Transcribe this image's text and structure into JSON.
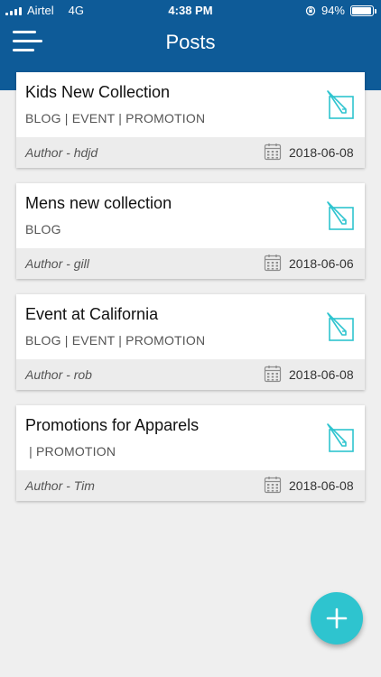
{
  "status_bar": {
    "carrier": "Airtel",
    "network": "4G",
    "time": "4:38 PM",
    "battery": "94%",
    "battery_level": 0.94
  },
  "header": {
    "title": "Posts",
    "menu_icon": "menu-icon"
  },
  "posts": [
    {
      "title": "Kids New Collection",
      "tags": "BLOG | EVENT | PROMOTION",
      "author": "Author - hdjd",
      "date": "2018-06-08"
    },
    {
      "title": "Mens new collection",
      "tags": "BLOG",
      "author": "Author - gill",
      "date": "2018-06-06"
    },
    {
      "title": "Event at California",
      "tags": "BLOG | EVENT | PROMOTION",
      "author": "Author - rob",
      "date": "2018-06-08"
    },
    {
      "title": "Promotions for Apparels",
      "tags": " | PROMOTION",
      "author": "Author - Tim",
      "date": "2018-06-08"
    }
  ],
  "colors": {
    "header": "#0e5b98",
    "accent": "#2ec4cf",
    "background": "#efefef"
  },
  "fab": {
    "icon": "plus-icon"
  }
}
